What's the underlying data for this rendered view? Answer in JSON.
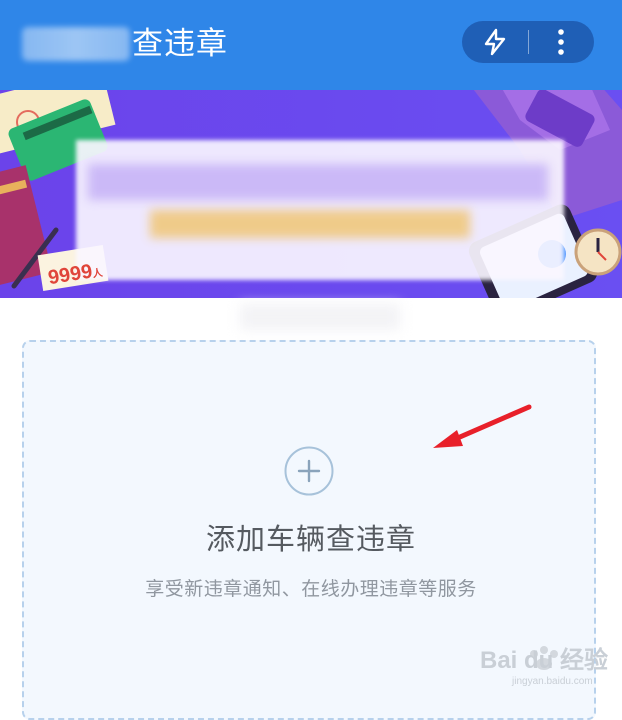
{
  "header": {
    "title": "查违章",
    "actions": [
      {
        "icon": "lightning-icon"
      },
      {
        "icon": "more-vertical-icon"
      }
    ],
    "color": "#2f86e8"
  },
  "banner": {
    "price_text": "9999",
    "price_unit": "人",
    "background": "#6a46ec"
  },
  "add_card": {
    "icon": "plus-circle-icon",
    "title": "添加车辆查违章",
    "subtitle": "享受新违章通知、在线办理违章等服务"
  },
  "watermark": {
    "text": "Bai du 经验",
    "url_text": "jingyan.baidu.com"
  }
}
